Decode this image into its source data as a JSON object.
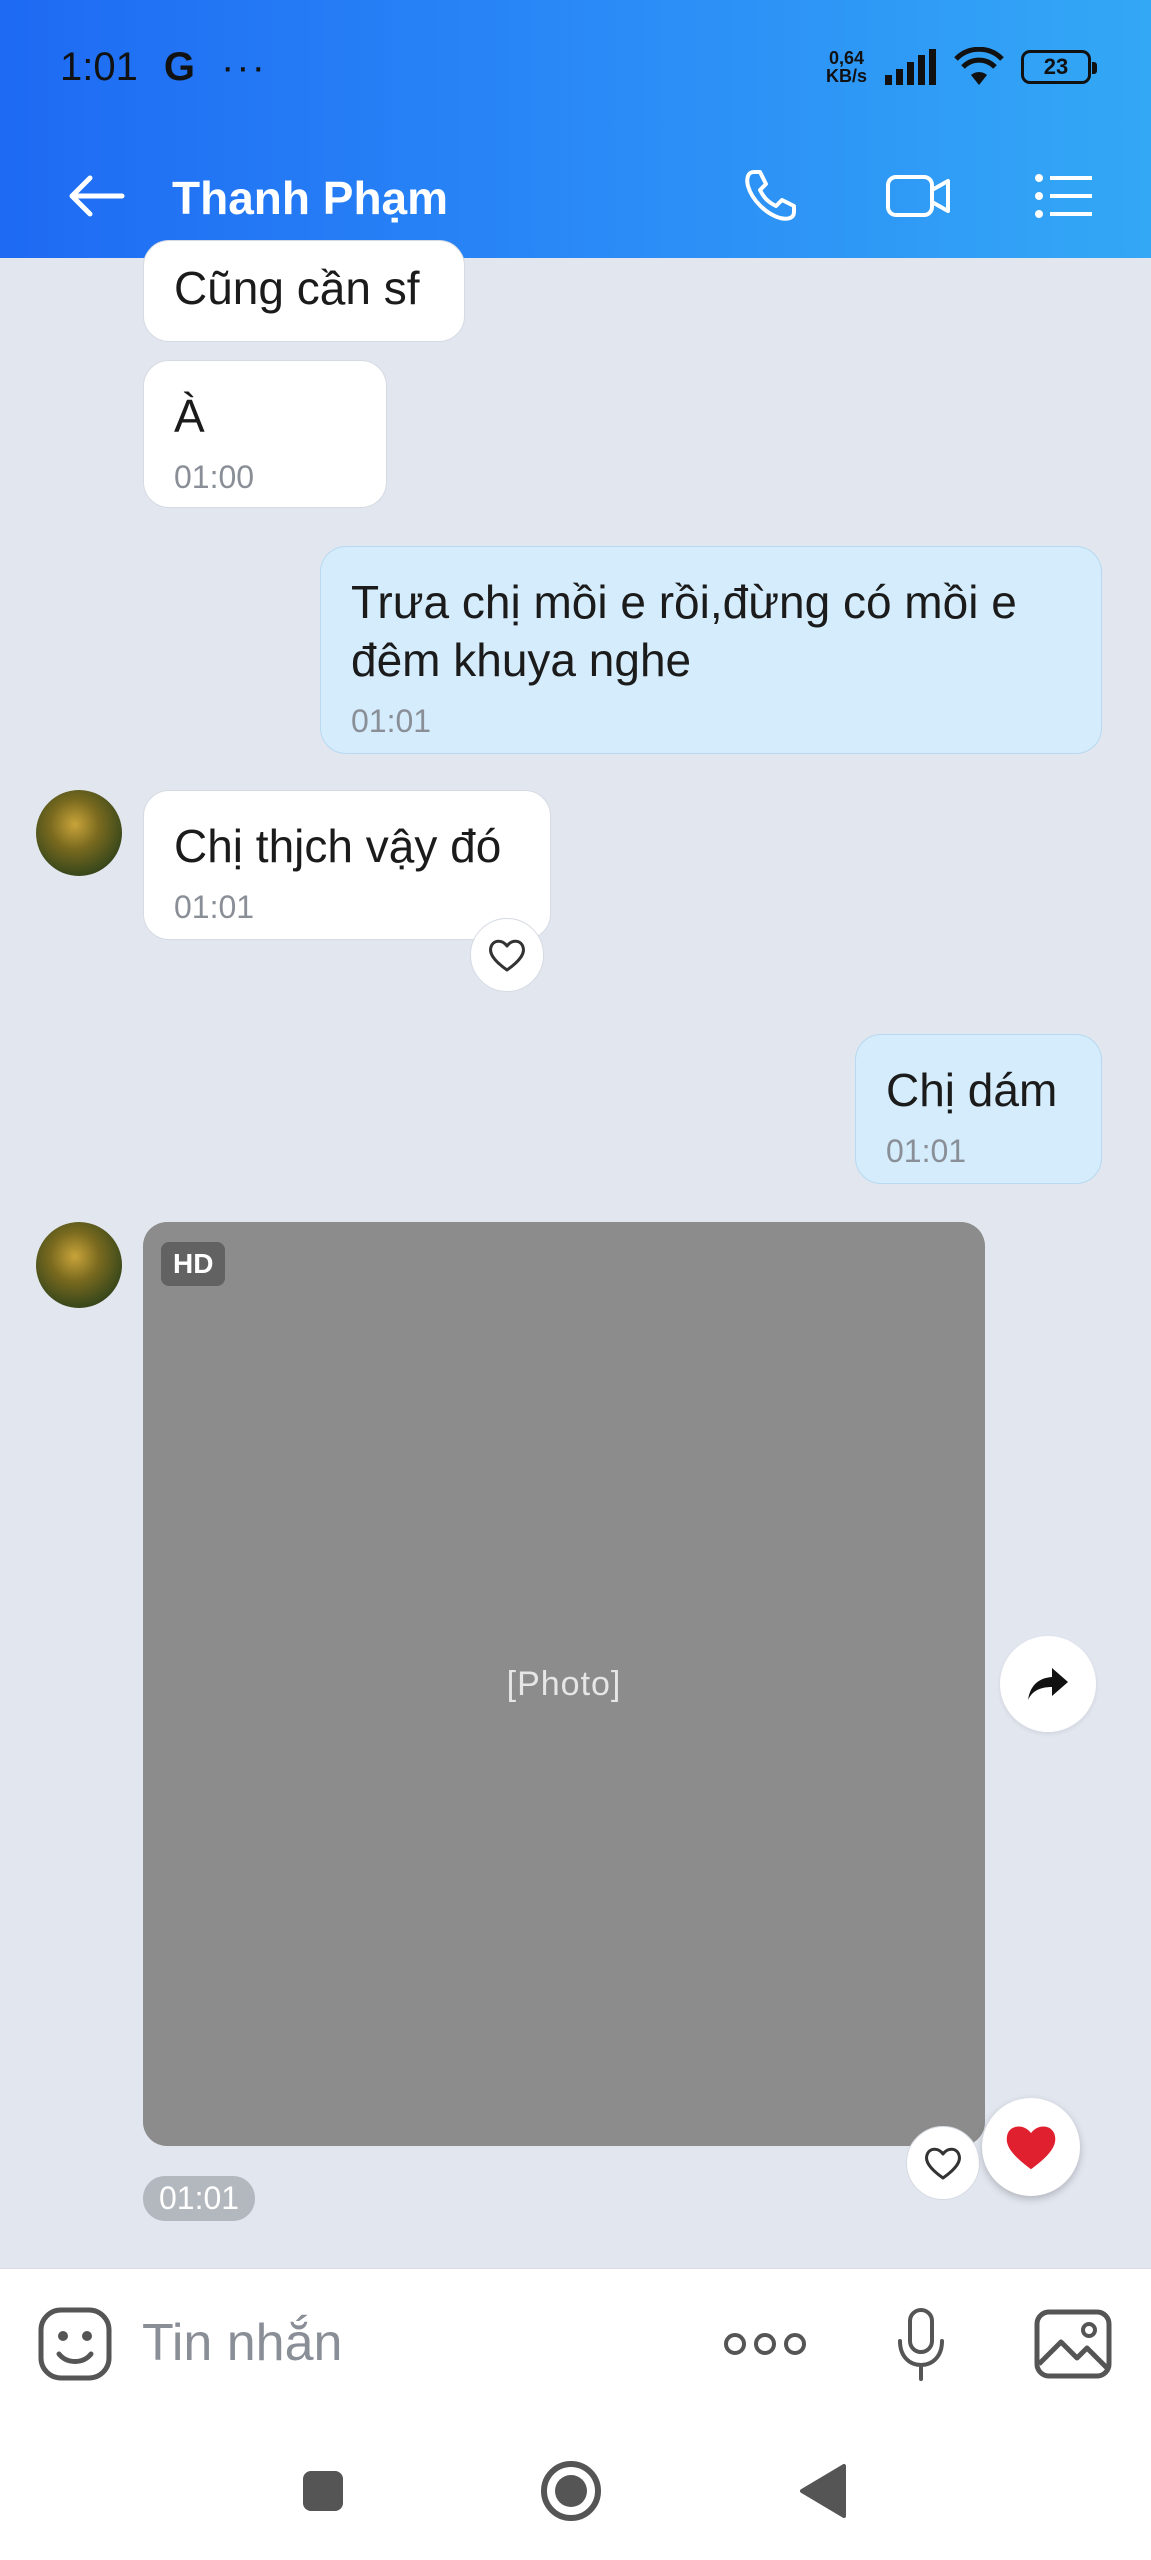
{
  "status_bar": {
    "time": "1:01",
    "carrier_icon": "G",
    "more": "···",
    "net_speed_value": "0,64",
    "net_speed_unit": "KB/s",
    "battery": "23"
  },
  "header": {
    "title": "Thanh Phạm",
    "back_icon": "arrow-left-icon",
    "call_icon": "phone-icon",
    "video_icon": "video-camera-icon",
    "menu_icon": "list-menu-icon"
  },
  "messages": [
    {
      "id": "m1",
      "sender": "other",
      "text": "Cũng cần sf",
      "time": ""
    },
    {
      "id": "m2",
      "sender": "other",
      "text": "À",
      "time": "01:00"
    },
    {
      "id": "m3",
      "sender": "me",
      "text": "Trưa chị mồi e rồi,đừng có mồi e đêm khuya nghe",
      "time": "01:01"
    },
    {
      "id": "m4",
      "sender": "other",
      "text": "Chị thjch vậy đó",
      "time": "01:01"
    },
    {
      "id": "m5",
      "sender": "me",
      "text": "Chị dám",
      "time": "01:01"
    }
  ],
  "photo_message": {
    "badge": "HD",
    "time": "01:01",
    "placeholder": "[Photo]"
  },
  "composer": {
    "placeholder": "Tin nhắn"
  },
  "colors": {
    "header_start": "#1e6af3",
    "header_end": "#33a8f5",
    "my_bubble": "#d4ecfb",
    "other_bubble": "#ffffff",
    "background": "#e2e6ef",
    "reaction_heart": "#e0202f"
  }
}
